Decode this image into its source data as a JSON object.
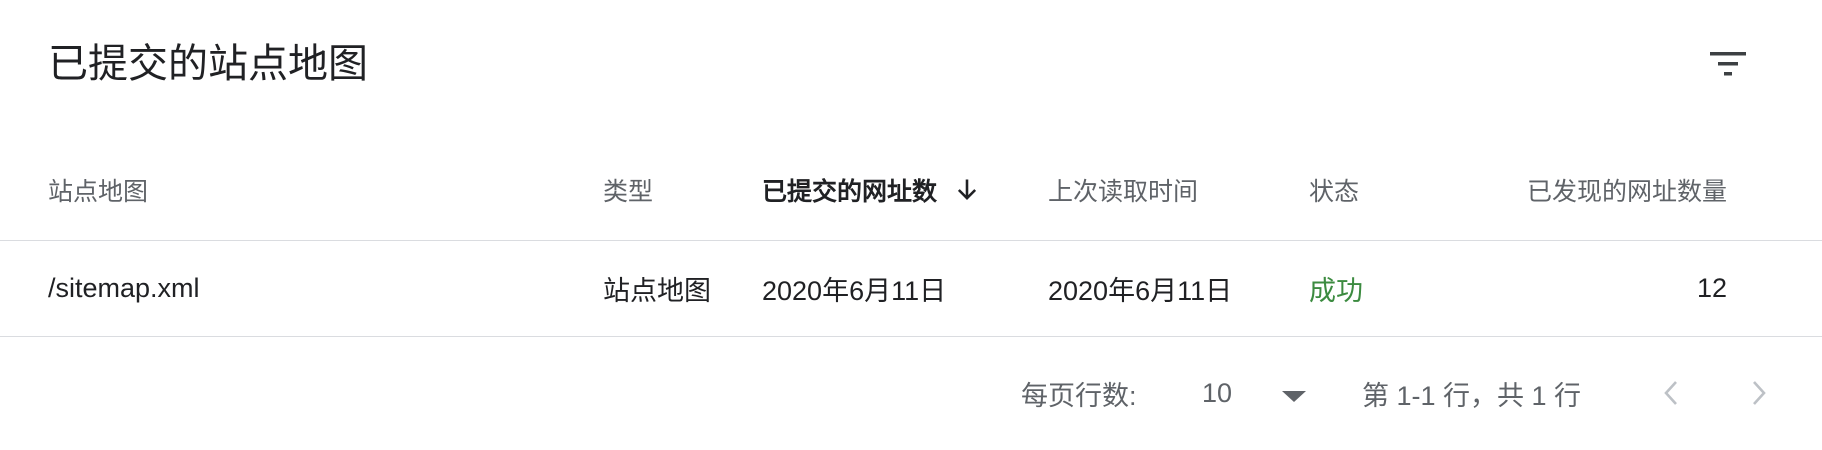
{
  "card": {
    "title": "已提交的站点地图"
  },
  "icons": {
    "filter": "filter-icon",
    "sort": "arrow-down-icon",
    "dropdown": "triangle-down-icon",
    "prev": "chevron-left-icon",
    "next": "chevron-right-icon"
  },
  "table": {
    "columns": [
      {
        "label": "站点地图"
      },
      {
        "label": "类型"
      },
      {
        "label": "已提交的网址数",
        "sorted": "desc"
      },
      {
        "label": "上次读取时间"
      },
      {
        "label": "状态"
      },
      {
        "label": "已发现的网址数量"
      }
    ],
    "rows": [
      {
        "sitemap": "/sitemap.xml",
        "type": "站点地图",
        "submitted": "2020年6月11日",
        "last_read": "2020年6月11日",
        "status": "成功",
        "discovered": "12"
      }
    ]
  },
  "footer": {
    "rows_per_page_label": "每页行数:",
    "rows_per_page_value": "10",
    "range_text": "第 1-1 行，共 1 行"
  },
  "colors": {
    "status_success": "#3c8b40",
    "divider": "#dadce0",
    "muted_text": "#5f6368",
    "text": "#202124"
  }
}
